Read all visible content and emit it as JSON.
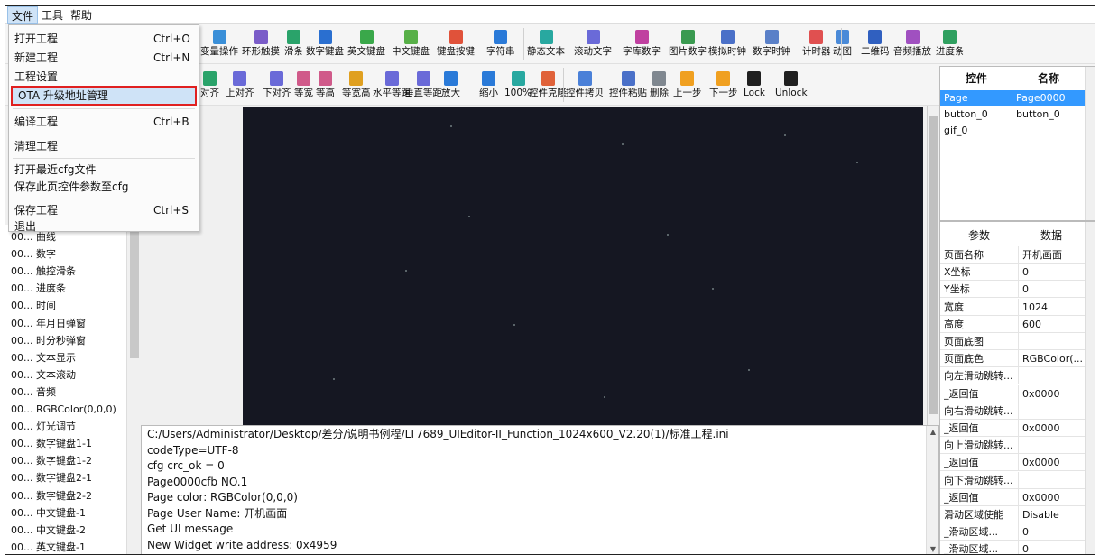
{
  "menubar": {
    "file": "文件",
    "tools": "工具",
    "help": "帮助"
  },
  "file_menu": {
    "open": "打开工程",
    "open_sc": "Ctrl+O",
    "new": "新建工程",
    "new_sc": "Ctrl+N",
    "settings": "工程设置",
    "ota": "OTA 升级地址管理",
    "compile": "编译工程",
    "compile_sc": "Ctrl+B",
    "clean": "清理工程",
    "open_recent": "打开最近cfg文件",
    "save_page": "保存此页控件参数至cfg",
    "save": "保存工程",
    "save_sc": "Ctrl+S",
    "exit": "退出"
  },
  "toolbar1": [
    {
      "label": "变量操作",
      "color": "#3a8fd8"
    },
    {
      "label": "环形触摸",
      "color": "#7a5cc8"
    },
    {
      "label": "滑条",
      "color": "#2aa36a"
    },
    {
      "label": "数字键盘",
      "color": "#2a6fd0"
    },
    {
      "label": "英文键盘",
      "color": "#3aa84a"
    },
    {
      "label": "中文键盘",
      "color": "#58b048"
    },
    {
      "label": "键盘按键",
      "color": "#e0523a"
    },
    {
      "label": "字符串",
      "color": "#2a7ad8"
    },
    {
      "label": "静态文本",
      "color": "#28a8a0"
    },
    {
      "label": "滚动文字",
      "color": "#6a6ad8"
    },
    {
      "label": "字库数字",
      "color": "#c040a0"
    },
    {
      "label": "图片数字",
      "color": "#3a9a50"
    },
    {
      "label": "模拟时钟",
      "color": "#4a70c8"
    },
    {
      "label": "数字时钟",
      "color": "#5a80c8"
    },
    {
      "label": "计时器",
      "color": "#e05050"
    },
    {
      "label": "动图",
      "color": "#4a8ad8"
    },
    {
      "label": "二维码",
      "color": "#3060c0"
    },
    {
      "label": "音频播放",
      "color": "#a050c0"
    },
    {
      "label": "进度条",
      "color": "#30a060"
    }
  ],
  "toolbar2": [
    {
      "label": "对齐",
      "color": "#2aa36a"
    },
    {
      "label": "上对齐",
      "color": "#6a6ad8"
    },
    {
      "label": "下对齐",
      "color": "#6a6ad8"
    },
    {
      "label": "等宽",
      "color": "#d05a8a"
    },
    {
      "label": "等高",
      "color": "#d05a8a"
    },
    {
      "label": "等宽高",
      "color": "#e0a020"
    },
    {
      "label": "水平等距",
      "color": "#6a6ad8"
    },
    {
      "label": "垂直等距",
      "color": "#6a6ad8"
    },
    {
      "label": "放大",
      "color": "#2a7ad8"
    },
    {
      "label": "缩小",
      "color": "#2a7ad8"
    },
    {
      "label": "100%",
      "color": "#28a8a0"
    },
    {
      "label": "控件克隆",
      "color": "#e0623a"
    },
    {
      "label": "控件拷贝",
      "color": "#4a80d8"
    },
    {
      "label": "控件粘贴",
      "color": "#4a70c8"
    },
    {
      "label": "删除",
      "color": "#808890"
    },
    {
      "label": "上一步",
      "color": "#f0a020"
    },
    {
      "label": "下一步",
      "color": "#f0a020"
    },
    {
      "label": "Lock",
      "color": "#202020"
    },
    {
      "label": "Unlock",
      "color": "#202020"
    }
  ],
  "left_list": [
    "00... 曲线",
    "00... 数字",
    "00... 触控滑条",
    "00... 进度条",
    "00... 时间",
    "00... 年月日弹窗",
    "00... 时分秒弹窗",
    "00... 文本显示",
    "00... 文本滚动",
    "00... 音频",
    "00... RGBColor(0,0,0)",
    "00... 灯光调节",
    "00... 数字键盘1-1",
    "00... 数字键盘1-2",
    "00... 数字键盘2-1",
    "00... 数字键盘2-2",
    "00... 中文键盘-1",
    "00... 中文键盘-2",
    "00... 英文键盘-1"
  ],
  "log": [
    "C:/Users/Administrator/Desktop/差分/说明书例程/LT7689_UIEditor-II_Function_1024x600_V2.20(1)/标准工程.ini",
    "codeType=UTF-8",
    "cfg crc_ok = 0",
    "Page0000cfb NO.1",
    "Page color: RGBColor(0,0,0)",
    "Page User Name: 开机画面",
    "Get UI message",
    "New Widget write address: 0x4959"
  ],
  "widgets": {
    "col1": "控件",
    "col2": "名称",
    "rows": [
      [
        "Page",
        "Page0000"
      ],
      [
        "button_0",
        "button_0"
      ],
      [
        "gif_0",
        ""
      ]
    ]
  },
  "props": {
    "col1": "参数",
    "col2": "数据",
    "rows": [
      [
        "页面名称",
        "开机画面"
      ],
      [
        "X坐标",
        "0"
      ],
      [
        "Y坐标",
        "0"
      ],
      [
        "宽度",
        "1024"
      ],
      [
        "高度",
        "600"
      ],
      [
        "页面底图",
        ""
      ],
      [
        "页面底色",
        "RGBColor(..."
      ],
      [
        "向左滑动跳转...",
        ""
      ],
      [
        "_返回值",
        "0x0000"
      ],
      [
        "向右滑动跳转...",
        ""
      ],
      [
        "_返回值",
        "0x0000"
      ],
      [
        "向上滑动跳转...",
        ""
      ],
      [
        "_返回值",
        "0x0000"
      ],
      [
        "向下滑动跳转...",
        ""
      ],
      [
        "_返回值",
        "0x0000"
      ],
      [
        "滑动区域使能",
        "Disable"
      ],
      [
        "_滑动区域...",
        "0"
      ],
      [
        "_滑动区域...",
        "0"
      ]
    ]
  }
}
